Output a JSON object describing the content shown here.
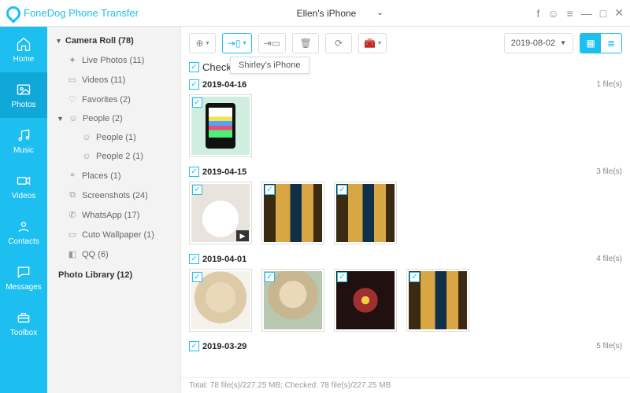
{
  "app": {
    "title": "FoneDog Phone Transfer"
  },
  "device": {
    "name": "Ellen's iPhone"
  },
  "nav": {
    "home": "Home",
    "photos": "Photos",
    "music": "Music",
    "videos": "Videos",
    "contacts": "Contacts",
    "messages": "Messages",
    "toolbox": "Toolbox"
  },
  "sidebar": {
    "cameraRoll": "Camera Roll (78)",
    "items": [
      {
        "icon": "✦",
        "label": "Live Photos (11)"
      },
      {
        "icon": "▭",
        "label": "Videos (11)"
      },
      {
        "icon": "♡",
        "label": "Favorites (2)"
      }
    ],
    "people": {
      "icon": "☺",
      "label": "People (2)"
    },
    "peopleSubs": [
      {
        "icon": "☺",
        "label": "People (1)"
      },
      {
        "icon": "☺",
        "label": "People 2 (1)"
      }
    ],
    "rest": [
      {
        "icon": "⌖",
        "label": "Places (1)"
      },
      {
        "icon": "⧉",
        "label": "Screenshots (24)"
      },
      {
        "icon": "✆",
        "label": "WhatsApp (17)"
      },
      {
        "icon": "▭",
        "label": "Cuto Wallpaper (1)"
      },
      {
        "icon": "◧",
        "label": "QQ (6)"
      }
    ],
    "photoLibrary": "Photo Library (12)"
  },
  "toolbar": {
    "tooltip": "Shirley's iPhone",
    "date": "2019-08-02"
  },
  "checkall": "Check All(78)",
  "groups": [
    {
      "date": "2019-04-16",
      "count": "1 file(s)",
      "thumbs": [
        {
          "cls": "ph-phone"
        }
      ]
    },
    {
      "date": "2019-04-15",
      "count": "3 file(s)",
      "thumbs": [
        {
          "cls": "ph-mug",
          "video": true
        },
        {
          "cls": "ph-drinks"
        },
        {
          "cls": "ph-drinks"
        }
      ]
    },
    {
      "date": "2019-04-01",
      "count": "4 file(s)",
      "thumbs": [
        {
          "cls": "ph-dog1"
        },
        {
          "cls": "ph-dog2"
        },
        {
          "cls": "ph-lights"
        },
        {
          "cls": "ph-drinks"
        }
      ]
    },
    {
      "date": "2019-03-29",
      "count": "5 file(s)",
      "thumbs": []
    }
  ],
  "footer": "Total: 78 file(s)/227.25 MB; Checked: 78 file(s)/227.25 MB"
}
